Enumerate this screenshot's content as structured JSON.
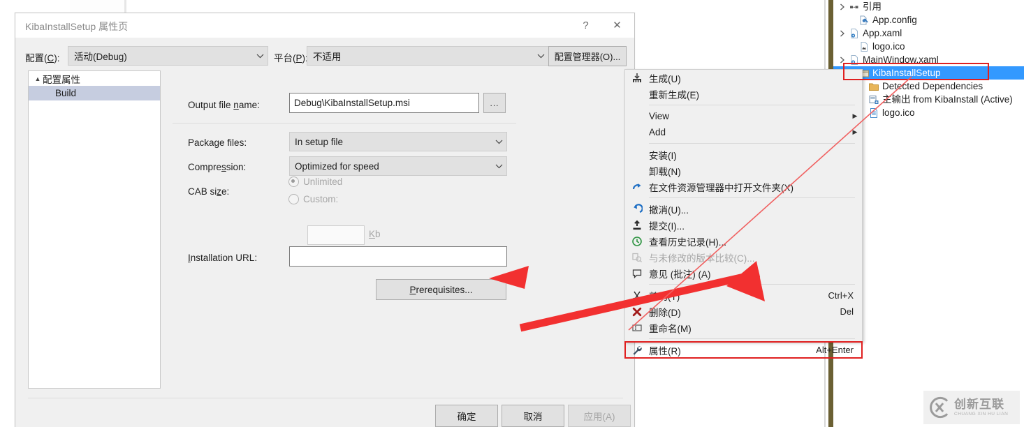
{
  "dialog": {
    "title": "KibaInstallSetup 属性页",
    "help_button": "?",
    "close_button": "✕",
    "configuration_label": "配置(C):",
    "configuration_value": "活动(Debug)",
    "platform_label": "平台(P):",
    "platform_value": "不适用",
    "config_manager_button": "配置管理器(O)...",
    "tree": {
      "root_label": "配置属性",
      "child_label": "Build"
    },
    "fields": {
      "output_file_name_label": "Output file name:",
      "output_file_name_value": "Debug\\KibaInstallSetup.msi",
      "browse_button": "...",
      "package_files_label": "Package files:",
      "package_files_value": "In setup file",
      "compression_label": "Compression:",
      "compression_value": "Optimized for speed",
      "cab_size_label": "CAB size:",
      "radio_unlimited": "Unlimited",
      "radio_custom": "Custom:",
      "cab_size_value": "",
      "cab_size_unit": "Kb",
      "installation_url_label": "Installation URL:",
      "installation_url_value": "",
      "prerequisites_button": "Prerequisites..."
    },
    "footer": {
      "ok": "确定",
      "cancel": "取消",
      "apply": "应用(A)"
    }
  },
  "context_menu": {
    "items": [
      {
        "label": "生成(U)",
        "icon": "build-icon",
        "shortcut": "",
        "submenu": false,
        "disabled": false,
        "highlight": false,
        "sep_after": false
      },
      {
        "label": "重新生成(E)",
        "icon": "",
        "shortcut": "",
        "submenu": false,
        "disabled": false,
        "highlight": false,
        "sep_after": true
      },
      {
        "label": "View",
        "icon": "",
        "shortcut": "",
        "submenu": true,
        "disabled": false,
        "highlight": false,
        "sep_after": false
      },
      {
        "label": "Add",
        "icon": "",
        "shortcut": "",
        "submenu": true,
        "disabled": false,
        "highlight": false,
        "sep_after": true
      },
      {
        "label": "安装(I)",
        "icon": "",
        "shortcut": "",
        "submenu": false,
        "disabled": false,
        "highlight": false,
        "sep_after": false
      },
      {
        "label": "卸载(N)",
        "icon": "",
        "shortcut": "",
        "submenu": false,
        "disabled": false,
        "highlight": false,
        "sep_after": false
      },
      {
        "label": "在文件资源管理器中打开文件夹(X)",
        "icon": "open-folder-icon",
        "shortcut": "",
        "submenu": false,
        "disabled": false,
        "highlight": false,
        "sep_after": true
      },
      {
        "label": "撤消(U)...",
        "icon": "undo-icon",
        "shortcut": "",
        "submenu": false,
        "disabled": false,
        "highlight": false,
        "sep_after": false
      },
      {
        "label": "提交(I)...",
        "icon": "commit-icon",
        "shortcut": "",
        "submenu": false,
        "disabled": false,
        "highlight": false,
        "sep_after": false
      },
      {
        "label": "查看历史记录(H)...",
        "icon": "history-icon",
        "shortcut": "",
        "submenu": false,
        "disabled": false,
        "highlight": false,
        "sep_after": false
      },
      {
        "label": "与未修改的版本比较(C)...",
        "icon": "compare-icon",
        "shortcut": "",
        "submenu": false,
        "disabled": true,
        "highlight": false,
        "sep_after": false
      },
      {
        "label": "意见 (批注) (A)",
        "icon": "comment-icon",
        "shortcut": "",
        "submenu": false,
        "disabled": false,
        "highlight": false,
        "sep_after": true
      },
      {
        "label": "剪切(T)",
        "icon": "cut-icon",
        "shortcut": "Ctrl+X",
        "submenu": false,
        "disabled": false,
        "highlight": false,
        "sep_after": false
      },
      {
        "label": "删除(D)",
        "icon": "delete-icon",
        "shortcut": "Del",
        "submenu": false,
        "disabled": false,
        "highlight": false,
        "sep_after": false
      },
      {
        "label": "重命名(M)",
        "icon": "rename-icon",
        "shortcut": "",
        "submenu": false,
        "disabled": false,
        "highlight": false,
        "sep_after": true
      },
      {
        "label": "属性(R)",
        "icon": "wrench-icon",
        "shortcut": "Alt+Enter",
        "submenu": false,
        "disabled": false,
        "highlight": true,
        "sep_after": false
      }
    ]
  },
  "solution_tree": {
    "items": [
      {
        "label": "引用",
        "icon": "references-icon",
        "expander": true,
        "indent": 1,
        "selected": false
      },
      {
        "label": "App.config",
        "icon": "config-file-icon",
        "expander": false,
        "indent": 2,
        "selected": false
      },
      {
        "label": "App.xaml",
        "icon": "xaml-file-icon",
        "expander": true,
        "indent": 1,
        "selected": false
      },
      {
        "label": "logo.ico",
        "icon": "ico-file-icon",
        "expander": false,
        "indent": 2,
        "selected": false
      },
      {
        "label": "MainWindow.xaml",
        "icon": "xaml-file-icon",
        "expander": true,
        "indent": 1,
        "selected": false
      },
      {
        "label": "KibaInstallSetup",
        "icon": "setup-project-icon",
        "expander": false,
        "indent": 2,
        "selected": true
      },
      {
        "label": "Detected Dependencies",
        "icon": "folder-icon",
        "expander": false,
        "indent": 3,
        "selected": false
      },
      {
        "label": "主输出 from KibaInstall (Active)",
        "icon": "output-icon",
        "expander": false,
        "indent": 3,
        "selected": false
      },
      {
        "label": "logo.ico",
        "icon": "ico-doc-icon",
        "expander": false,
        "indent": 3,
        "selected": false
      }
    ]
  },
  "watermark": {
    "cn": "创新互联",
    "en": "CHUANG XIN HU LIAN"
  },
  "colors": {
    "selection_blue": "#3399ff",
    "annotation_red": "#e02020",
    "dialog_bg": "#f0f0f0",
    "tree_selected_inner": "#c6cde0",
    "olive_divider": "#6b6033"
  }
}
